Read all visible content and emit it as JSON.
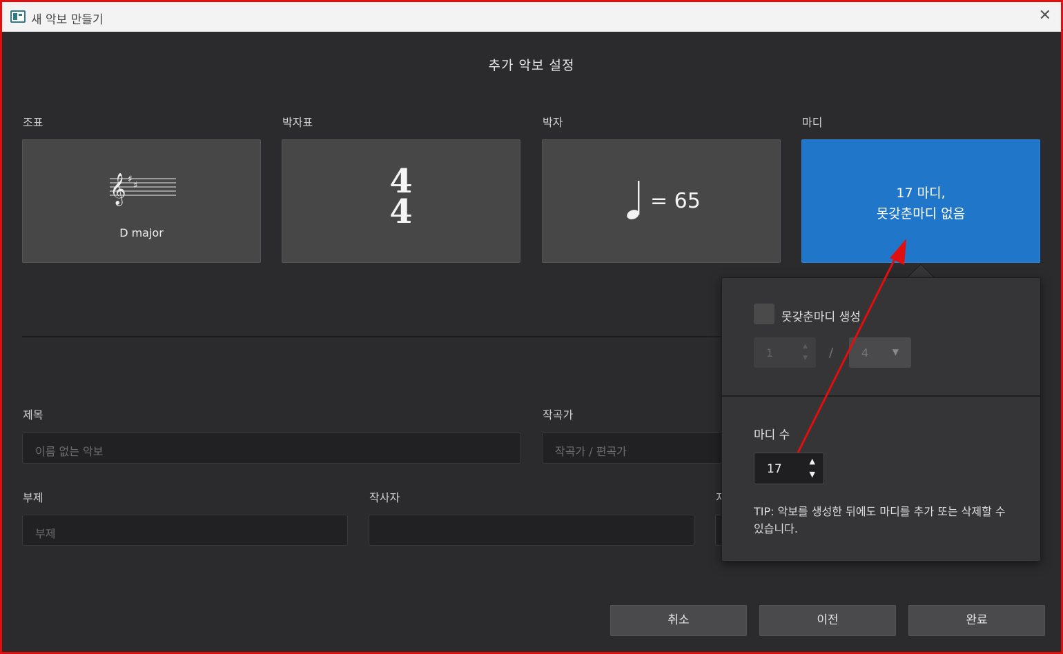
{
  "window": {
    "title": "새 악보 만들기",
    "close_glyph": "✕"
  },
  "dialog_title": "추가 악보 설정",
  "sections": {
    "key": {
      "label": "조표",
      "caption": "D major"
    },
    "time_signature": {
      "label": "박자표",
      "numerator": "4",
      "denominator": "4"
    },
    "tempo": {
      "label": "박자",
      "text": "= 65"
    },
    "measures": {
      "label": "마디",
      "line1": "17 마디,",
      "line2": "못갖춘마디 없음"
    }
  },
  "fields": {
    "title": {
      "label": "제목",
      "placeholder": "이름 없는 악보"
    },
    "composer": {
      "label": "작곡가",
      "placeholder": "작곡가 / 편곡가"
    },
    "subtitle": {
      "label": "부제",
      "placeholder": "부제"
    },
    "lyricist": {
      "label": "작사자",
      "placeholder": ""
    },
    "copyright": {
      "label_partial": "저"
    }
  },
  "popover": {
    "pickup_label": "못갖춘마디 생성",
    "pickup_checked": false,
    "pickup_numerator": "1",
    "pickup_slash": "/",
    "pickup_denominator": "4",
    "measure_count_label": "마디 수",
    "measure_count": "17",
    "tip_prefix": "TIP",
    "tip_text": ": 악보를 생성한 뒤에도 마디를 추가 또는 삭제할 수 있습니다."
  },
  "buttons": {
    "cancel": "취소",
    "previous": "이전",
    "finish": "완료"
  },
  "colors": {
    "accent_blue": "#2077c9",
    "annotation_red": "#e01010",
    "background": "#2b2b2d"
  }
}
